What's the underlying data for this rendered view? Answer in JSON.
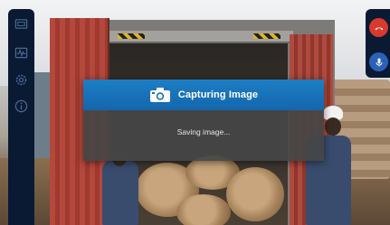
{
  "dialog": {
    "title": "Capturing Image",
    "message": "Saving image...",
    "header_color": "#1a73bd",
    "icon": "camera-icon"
  },
  "left_toolbar": {
    "icons": [
      "gallery-icon",
      "waveform-icon",
      "settings-gear-icon",
      "info-icon"
    ]
  },
  "right_controls": {
    "buttons": [
      {
        "name": "end-call-button",
        "icon": "phone-hangup-icon",
        "color": "#d83a2e"
      },
      {
        "name": "microphone-button",
        "icon": "microphone-icon",
        "color": "#2a62b8"
      }
    ]
  },
  "background": {
    "description_free": true
  }
}
